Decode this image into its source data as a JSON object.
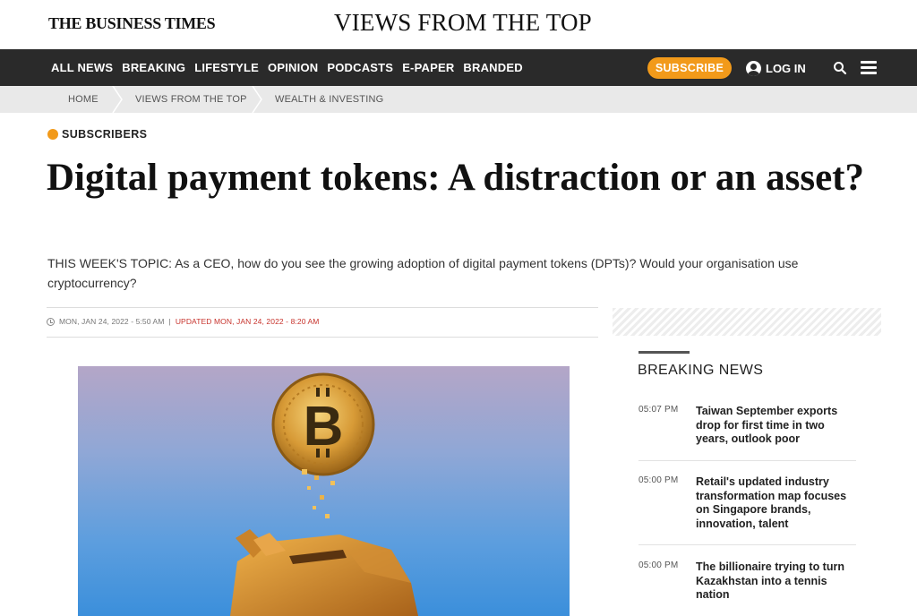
{
  "header": {
    "logo": "THE BUSINESS TIMES",
    "section_title": "VIEWS FROM THE TOP"
  },
  "nav": {
    "items": [
      {
        "label": "ALL NEWS"
      },
      {
        "label": "BREAKING"
      },
      {
        "label": "LIFESTYLE"
      },
      {
        "label": "OPINION"
      },
      {
        "label": "PODCASTS"
      },
      {
        "label": "E-PAPER"
      },
      {
        "label": "BRANDED"
      }
    ],
    "subscribe_label": "SUBSCRIBE",
    "login_label": "LOG IN",
    "icons": {
      "user": "user-icon",
      "search": "search-icon",
      "menu": "hamburger-menu-icon"
    },
    "colors": {
      "bar": "#2a2a2a",
      "accent": "#f29a1a"
    }
  },
  "breadcrumb": {
    "items": [
      {
        "label": "HOME"
      },
      {
        "label": "VIEWS FROM THE TOP"
      },
      {
        "label": "WEALTH & INVESTING"
      }
    ]
  },
  "article": {
    "badge": "SUBSCRIBERS",
    "headline": "Digital payment tokens: A distraction or an asset?",
    "topic": "THIS WEEK'S TOPIC: As a CEO, how do you see the growing adoption of digital payment tokens (DPTs)? Would your organisation use cryptocurrency?",
    "published": "MON, JAN 24, 2022 - 5:50 AM",
    "separator": "|",
    "updated": "UPDATED MON, JAN 24, 2022 - 8:20 AM",
    "image_subject": "bitcoin coin dropping into piggy bank"
  },
  "sidebar": {
    "breaking_title": "BREAKING NEWS",
    "items": [
      {
        "time": "05:07 PM",
        "text": "Taiwan September exports drop for first time in two years, outlook poor"
      },
      {
        "time": "05:00 PM",
        "text": "Retail's updated industry transformation map focuses on Singapore brands, innovation, talent"
      },
      {
        "time": "05:00 PM",
        "text": "The billionaire trying to turn Kazakhstan into a tennis nation"
      }
    ]
  }
}
